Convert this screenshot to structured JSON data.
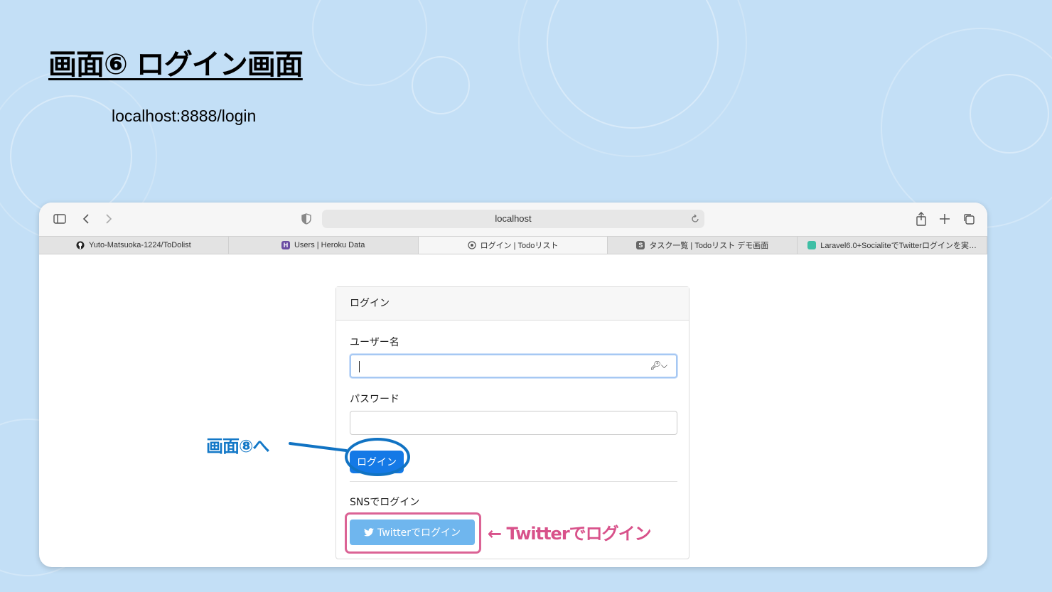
{
  "slide": {
    "title": "画面⑥ ログイン画面",
    "url_caption": "localhost:8888/login"
  },
  "browser": {
    "address": "localhost",
    "tabs": [
      {
        "label": "Yuto-Matsuoka-1224/ToDolist",
        "icon": "github-icon",
        "icon_glyph": ""
      },
      {
        "label": "Users | Heroku Data",
        "icon": "heroku-icon",
        "icon_glyph": "H"
      },
      {
        "label": "ログイン | Todoリスト",
        "icon": "page-icon",
        "icon_glyph": ""
      },
      {
        "label": "タスク一覧 | Todoリスト デモ画面",
        "icon": "s-icon",
        "icon_glyph": "S"
      },
      {
        "label": "Laravel6.0+SocialiteでTwitterログインを実…",
        "icon": "qiita-icon",
        "icon_glyph": ""
      }
    ],
    "active_tab": 2
  },
  "login": {
    "header": "ログイン",
    "username_label": "ユーザー名",
    "username_value": "",
    "password_label": "パスワード",
    "password_value": "",
    "login_button": "ログイン",
    "sns_label": "SNSでログイン",
    "twitter_button": "Twitterでログイン"
  },
  "annotations": {
    "to_screen8": "画面⑧へ",
    "twitter_login": "← Twitterでログイン"
  },
  "colors": {
    "background": "#c3dff6",
    "primary_button": "#1479e6",
    "twitter_button": "#6fb6ee",
    "annotation_blue": "#1378c7",
    "annotation_pink": "#d8518a"
  }
}
